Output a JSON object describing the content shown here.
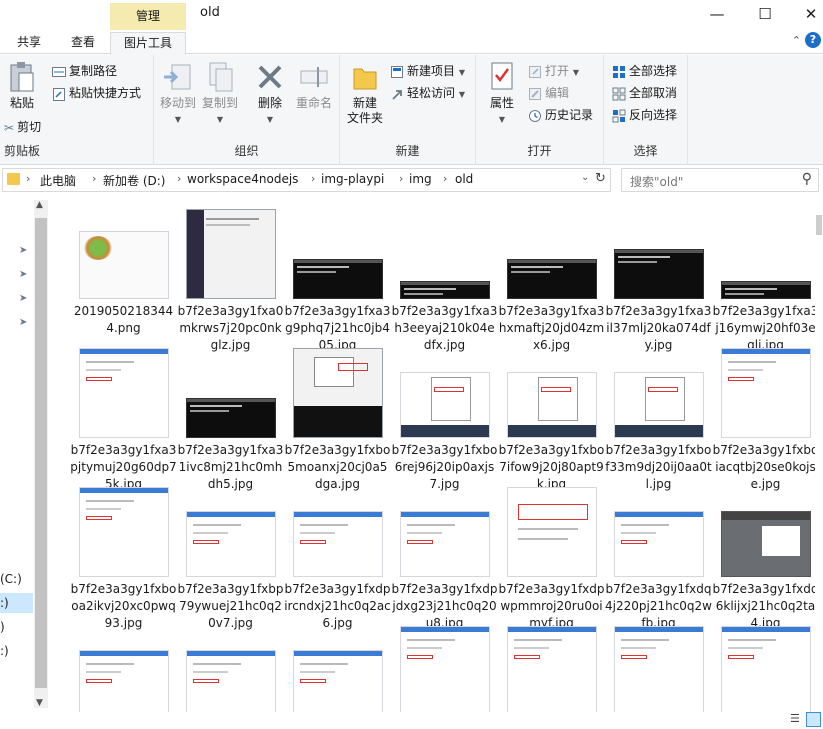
{
  "window": {
    "title": "old",
    "context_tab": "管理",
    "min_icon": "minimize-icon",
    "max_icon": "maximize-icon",
    "close_icon": "close-icon"
  },
  "ribbon_tabs": {
    "share": "共享",
    "view": "查看",
    "picture_tools": "图片工具"
  },
  "ribbon": {
    "clipboard": {
      "label": "剪贴板",
      "paste": "粘贴",
      "cut": "剪切",
      "copy_path": "复制路径",
      "paste_shortcut": "粘贴快捷方式"
    },
    "organize": {
      "label": "组织",
      "move_to": "移动到",
      "copy_to": "复制到",
      "delete": "删除",
      "rename": "重命名"
    },
    "new": {
      "label": "新建",
      "new_folder_line1": "新建",
      "new_folder_line2": "文件夹",
      "new_item": "新建项目",
      "easy_access": "轻松访问"
    },
    "open": {
      "label": "打开",
      "properties": "属性",
      "open": "打开",
      "edit": "编辑",
      "history": "历史记录"
    },
    "select": {
      "label": "选择",
      "select_all": "全部选择",
      "select_none": "全部取消",
      "invert": "反向选择"
    }
  },
  "address": {
    "crumbs": [
      "此电脑",
      "新加卷 (D:)",
      "workspace4nodejs",
      "img-playpi",
      "img",
      "old"
    ],
    "search_placeholder": "搜索\"old\""
  },
  "nav": {
    "drives": [
      "(C:)",
      ":)",
      ")",
      ":)"
    ]
  },
  "files": [
    {
      "name": "20190502183444.png",
      "thumb": "photo"
    },
    {
      "name": "b7f2e3a3gy1fxa0mkrws7j20pc0nkglz.jpg",
      "thumb": "window"
    },
    {
      "name": "b7f2e3a3gy1fxa3g9phq7j21hc0jb405.jpg",
      "thumb": "terminal"
    },
    {
      "name": "b7f2e3a3gy1fxa3h3eeyaj210k04edfx.jpg",
      "thumb": "terminal-thin"
    },
    {
      "name": "b7f2e3a3gy1fxa3hxmaftj20jd04zmx6.jpg",
      "thumb": "terminal"
    },
    {
      "name": "b7f2e3a3gy1fxa3il37mlj20ka074dfy.jpg",
      "thumb": "terminal-tall"
    },
    {
      "name": "b7f2e3a3gy1fxa3j16ymwj20hf03eglj.jpg",
      "thumb": "terminal-thin"
    },
    {
      "name": "b7f2e3a3gy1fxa3pjtymuj20g60dp75k.jpg",
      "thumb": "dialog"
    },
    {
      "name": "b7f2e3a3gy1fxa31ivc8mj21hc0mhdh5.jpg",
      "thumb": "terminal"
    },
    {
      "name": "b7f2e3a3gy1fxbo5moanxj20cj0a5dga.jpg",
      "thumb": "menu-dark"
    },
    {
      "name": "b7f2e3a3gy1fxbo6rej96j20ip0axjs7.jpg",
      "thumb": "menu"
    },
    {
      "name": "b7f2e3a3gy1fxbo7ifow9j20j80apt9k.jpg",
      "thumb": "menu"
    },
    {
      "name": "b7f2e3a3gy1fxbof33m9dj20ij0aa0tl.jpg",
      "thumb": "menu"
    },
    {
      "name": "b7f2e3a3gy1fxboiacqtbj20se0kojse.jpg",
      "thumb": "dialog"
    },
    {
      "name": "b7f2e3a3gy1fxbooa2ikvj20xc0pwq93.jpg",
      "thumb": "settings"
    },
    {
      "name": "b7f2e3a3gy1fxbp79ywuej21hc0q20v7.jpg",
      "thumb": "web"
    },
    {
      "name": "b7f2e3a3gy1fxdpircndxj21hc0q2ac6.jpg",
      "thumb": "web"
    },
    {
      "name": "b7f2e3a3gy1fxdpjdxg23j21hc0q20u8.jpg",
      "thumb": "web"
    },
    {
      "name": "b7f2e3a3gy1fxdpwpmmroj20ru0oimyf.jpg",
      "thumb": "doc"
    },
    {
      "name": "b7f2e3a3gy1fxdq4j220pj21hc0q2wfb.jpg",
      "thumb": "web"
    },
    {
      "name": "b7f2e3a3gy1fxdq6klijxj21hc0q2ta4.jpg",
      "thumb": "gray"
    },
    {
      "name": "",
      "thumb": "web"
    },
    {
      "name": "",
      "thumb": "web"
    },
    {
      "name": "",
      "thumb": "web"
    },
    {
      "name": "",
      "thumb": "form"
    },
    {
      "name": "",
      "thumb": "form"
    },
    {
      "name": "",
      "thumb": "form"
    },
    {
      "name": "",
      "thumb": "form"
    }
  ],
  "colors": {
    "accent": "#1c6fc9",
    "context_tab": "#f5ebb0",
    "selected": "#cce8ff",
    "folder": "#f2c94c"
  }
}
